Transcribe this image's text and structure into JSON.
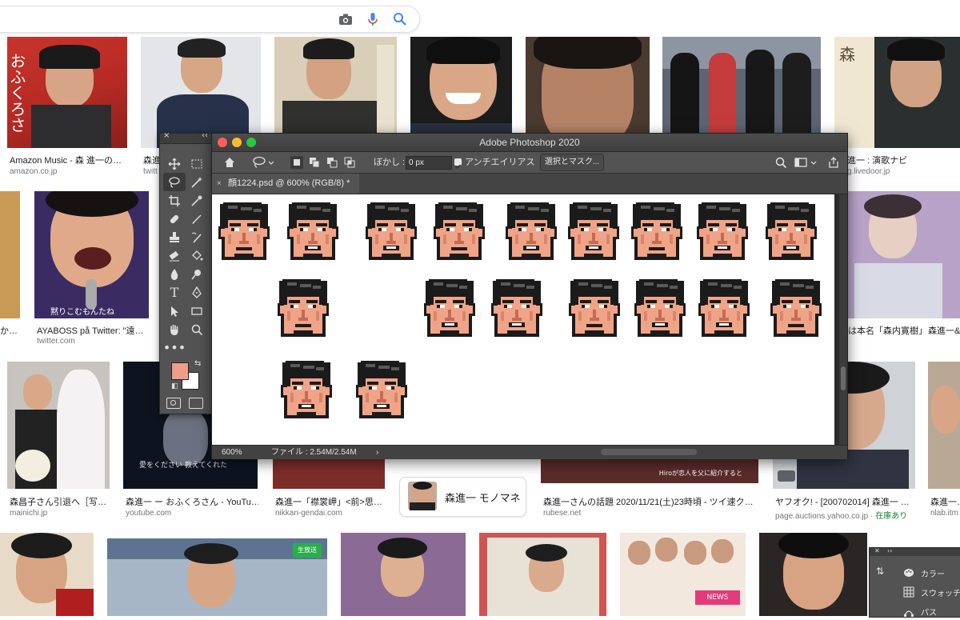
{
  "search": {
    "icons": [
      "camera-icon",
      "microphone-icon",
      "search-icon"
    ]
  },
  "results_row1": [
    {
      "title": "Amazon Music - 森 進一の…",
      "source": "amazon.co.jp"
    },
    {
      "title": "森進",
      "source": "twitt"
    },
    {
      "title": "",
      "source": ""
    },
    {
      "title": "",
      "source": ""
    },
    {
      "title": "進一 : 演歌ナビ",
      "source": "g.livedoor.jp"
    }
  ],
  "results_row2": [
    {
      "title": "か…",
      "source": ""
    },
    {
      "title": "AYABOSS på Twitter: \"遠…",
      "source": "twitter.com"
    },
    {
      "title": "は本名「森内寛樹」",
      "source": ""
    },
    {
      "title": "森進一&",
      "source": ""
    }
  ],
  "results_row3": [
    {
      "title": "森昌子さん引退へ［写…",
      "source": "mainichi.jp"
    },
    {
      "title": "森進一 ー おふくろさん - YouTu…",
      "source": "youtube.com"
    },
    {
      "title": "森進一「襟裳岬」<前>思…",
      "source": "nikkan-gendai.com"
    },
    {
      "title": "森進一さんの話題 2020/11/21(土)23時頃 - ツイ速ク…",
      "source": "rubese.net"
    },
    {
      "title": "ヤフオク! - [20070201​4] 森進一 …",
      "source": "page.auctions.yahoo.co.jp",
      "stock": "在庫あり"
    },
    {
      "title": "森進一…",
      "source": "nlab.itm"
    }
  ],
  "related": {
    "label": "森進一 モノマネ"
  },
  "photoshop": {
    "window_title": "Adobe Photoshop 2020",
    "feather_label": "ぼかし :",
    "feather_value": "0 px",
    "antialias_label": "アンチエイリアス",
    "mask_button": "選択とマスク...",
    "tab_name": "顔1224.psd @ 600% (RGB/8) *",
    "status_zoom": "600%",
    "status_file": "ファイル : 2.54M/2.54M",
    "status_arrow": "›",
    "foreground_color": "#ee9e88",
    "background_color": "#ffffff"
  },
  "side_panel": {
    "items": [
      {
        "icon": "palette-icon",
        "label": "カラー"
      },
      {
        "icon": "grid-icon",
        "label": "スウォッチ"
      },
      {
        "icon": "pen-path-icon",
        "label": "パス"
      }
    ]
  },
  "pixel_faces": {
    "rows": [
      {
        "count": 9
      },
      {
        "count": 7
      },
      {
        "count": 2
      }
    ]
  }
}
